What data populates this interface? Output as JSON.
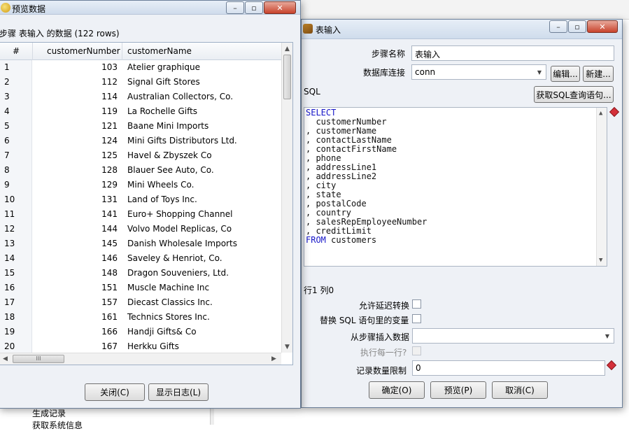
{
  "background": {
    "tree_item_1": "生成记录",
    "tree_item_2": "获取系统信息"
  },
  "preview_window": {
    "title": "预览数据",
    "heading": "步骤 表输入 的数据  (122 rows)",
    "columns": [
      "#",
      "customerNumber",
      "customerName"
    ],
    "rows": [
      [
        "1",
        "103",
        "Atelier graphique"
      ],
      [
        "2",
        "112",
        "Signal Gift Stores"
      ],
      [
        "3",
        "114",
        "Australian Collectors, Co."
      ],
      [
        "4",
        "119",
        "La Rochelle Gifts"
      ],
      [
        "5",
        "121",
        "Baane Mini Imports"
      ],
      [
        "6",
        "124",
        "Mini Gifts Distributors Ltd."
      ],
      [
        "7",
        "125",
        "Havel & Zbyszek Co"
      ],
      [
        "8",
        "128",
        "Blauer See Auto, Co."
      ],
      [
        "9",
        "129",
        "Mini Wheels Co."
      ],
      [
        "10",
        "131",
        "Land of Toys Inc."
      ],
      [
        "11",
        "141",
        "Euro+ Shopping Channel"
      ],
      [
        "12",
        "144",
        "Volvo Model Replicas, Co"
      ],
      [
        "13",
        "145",
        "Danish Wholesale Imports"
      ],
      [
        "14",
        "146",
        "Saveley & Henriot, Co."
      ],
      [
        "15",
        "148",
        "Dragon Souveniers, Ltd."
      ],
      [
        "16",
        "151",
        "Muscle Machine Inc"
      ],
      [
        "17",
        "157",
        "Diecast Classics Inc."
      ],
      [
        "18",
        "161",
        "Technics Stores Inc."
      ],
      [
        "19",
        "166",
        "Handji Gifts& Co"
      ],
      [
        "20",
        "167",
        "Herkku Gifts"
      ]
    ],
    "close_button": "关闭(C)",
    "show_log_button": "显示日志(L)",
    "hscroll_grip": "III"
  },
  "table_input_window": {
    "title": "表输入",
    "step_name_label": "步骤名称",
    "step_name_value": "表输入",
    "db_conn_label": "数据库连接",
    "db_conn_value": "conn",
    "edit_button": "编辑...",
    "new_button": "新建...",
    "sql_label": "SQL",
    "get_sql_button": "获取SQL查询语句...",
    "sql_lines": [
      {
        "kw": "SELECT",
        "text": ""
      },
      {
        "kw": "",
        "text": "  customerNumber"
      },
      {
        "kw": "",
        "text": ", customerName"
      },
      {
        "kw": "",
        "text": ", contactLastName"
      },
      {
        "kw": "",
        "text": ", contactFirstName"
      },
      {
        "kw": "",
        "text": ", phone"
      },
      {
        "kw": "",
        "text": ", addressLine1"
      },
      {
        "kw": "",
        "text": ", addressLine2"
      },
      {
        "kw": "",
        "text": ", city"
      },
      {
        "kw": "",
        "text": ", state"
      },
      {
        "kw": "",
        "text": ", postalCode"
      },
      {
        "kw": "",
        "text": ", country"
      },
      {
        "kw": "",
        "text": ", salesRepEmployeeNumber"
      },
      {
        "kw": "",
        "text": ", creditLimit"
      },
      {
        "kw": "FROM",
        "text": " customers"
      }
    ],
    "cursor_pos": "行1 列0",
    "lazy_conversion_label": "允许延迟转换",
    "replace_vars_label": "替换 SQL 语句里的变量",
    "insert_from_step_label": "从步骤插入数据",
    "insert_from_step_value": "",
    "execute_each_row_label": "执行每一行?",
    "limit_label": "记录数量限制",
    "limit_value": "0",
    "ok_button": "确定(O)",
    "preview_button": "预览(P)",
    "cancel_button": "取消(C)"
  },
  "colors": {
    "sql_keyword": "#1515c8",
    "required_marker": "#d4303a",
    "window_bg": "#eef1f6"
  }
}
